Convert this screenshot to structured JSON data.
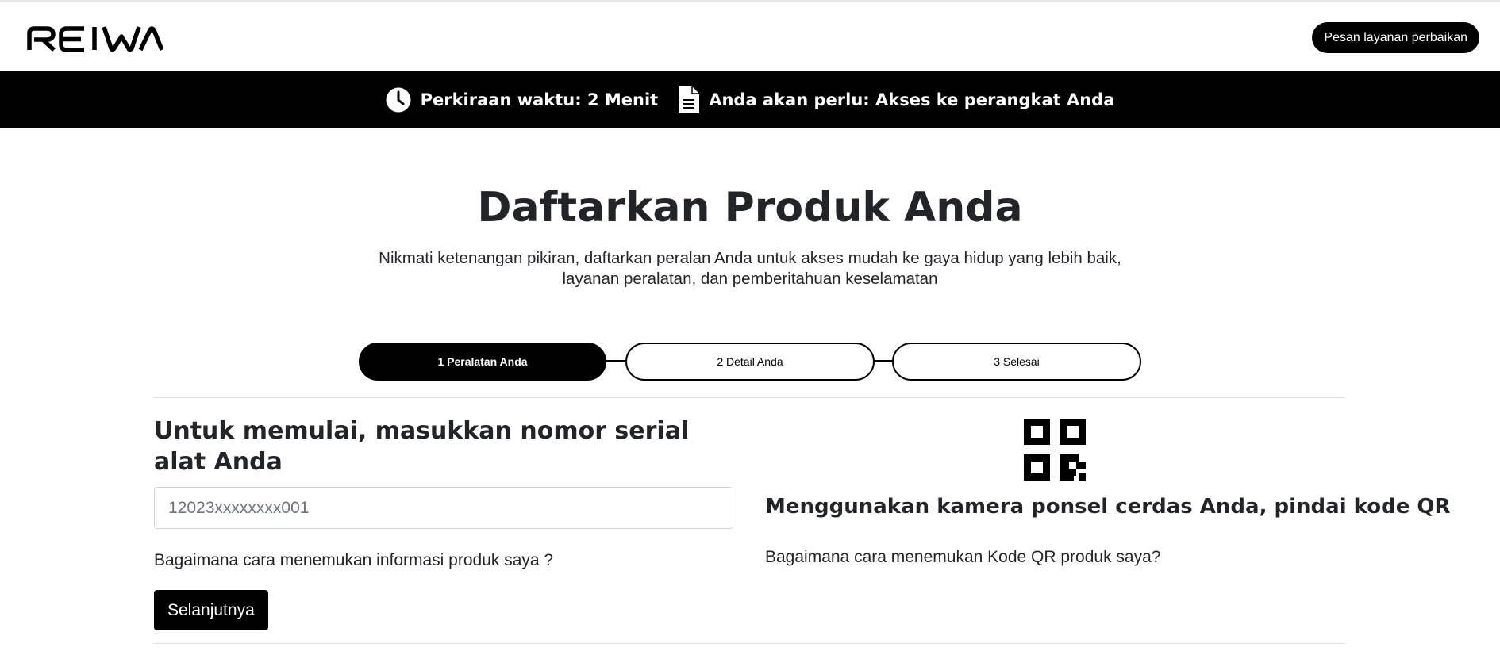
{
  "brand": {
    "logo_text": "REIWA"
  },
  "header": {
    "book_service_label": "Pesan layanan perbaikan"
  },
  "info_bar": {
    "time_label": "Perkiraan waktu:",
    "time_value": "2 Menit",
    "need_label": "Anda akan perlu:",
    "need_value": "Akses ke perangkat Anda"
  },
  "main": {
    "title": "Daftarkan Produk Anda",
    "subtitle_line1": "Nikmati ketenangan pikiran, daftarkan peralan Anda untuk akses mudah ke gaya hidup yang lebih baik,",
    "subtitle_line2": "layanan peralatan, dan pemberitahuan keselamatan"
  },
  "steps": [
    {
      "label": "1 Peralatan Anda",
      "active": true
    },
    {
      "label": "2 Detail Anda",
      "active": false
    },
    {
      "label": "3 Selesai",
      "active": false
    }
  ],
  "serial_form": {
    "heading": "Untuk memulai, masukkan nomor serial alat Anda",
    "input_value": "",
    "input_placeholder": "12023xxxxxxxx001",
    "help_link": "Bagaimana cara menemukan informasi produk saya ?",
    "next_label": "Selanjutnya"
  },
  "qr_section": {
    "icon": "qr-code-icon",
    "heading": "Menggunakan kamera ponsel cerdas Anda, pindai kode QR",
    "help_link": "Bagaimana cara menemukan Kode QR produk saya?"
  },
  "colors": {
    "primary": "#000000",
    "on_primary": "#ffffff",
    "text": "#212529",
    "divider": "#dee2e6"
  }
}
